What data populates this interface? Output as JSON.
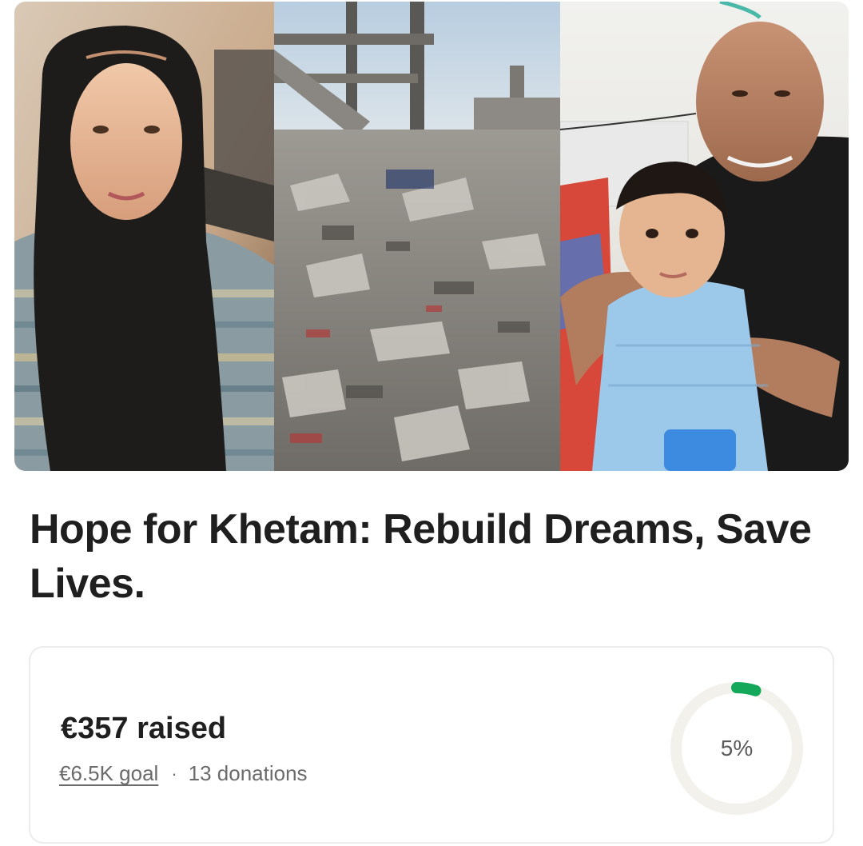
{
  "campaign": {
    "title": "Hope for Khetam: Rebuild Dreams, Save Lives.",
    "photos": [
      "portrait-of-woman-in-black-hijab",
      "destroyed-building-rubble",
      "man-with-child-in-hospital"
    ]
  },
  "progress": {
    "raised_label": "€357 raised",
    "goal_label": "€6.5K goal",
    "separator": "·",
    "donations_label": "13 donations",
    "percent_label": "5%",
    "percent_value": 0.05,
    "colors": {
      "accent": "#13a85a",
      "track": "#f2f1ec",
      "text": "#1f1f1f",
      "muted": "#6b6b6b"
    }
  }
}
